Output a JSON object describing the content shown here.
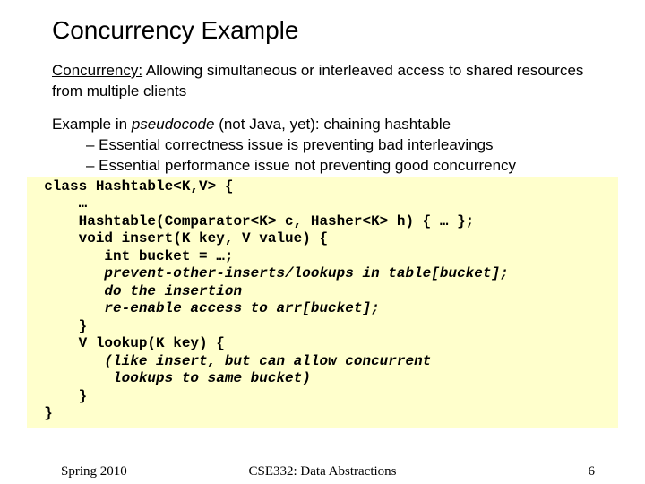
{
  "title": "Concurrency Example",
  "para1": {
    "term": "Concurrency:",
    "rest": " Allowing simultaneous or interleaved access to shared resources from multiple clients"
  },
  "para2": {
    "pre": "Example in ",
    "italic": "pseudocode",
    "post": " (not Java, yet): chaining hashtable"
  },
  "bullet1": "–  Essential correctness issue is preventing bad interleavings",
  "bullet2": "–  Essential performance issue not preventing good concurrency",
  "code": {
    "l1": "  class Hashtable<K,V> {",
    "l2": "      …",
    "l3": "      Hashtable(Comparator<K> c, Hasher<K> h) { … };",
    "l4": "      void insert(K key, V value) {",
    "l5": "         int bucket = …;",
    "l6": "         prevent-other-inserts/lookups in table[bucket];",
    "l7": "         do the insertion",
    "l8": "         re-enable access to arr[bucket];",
    "l9": "      }",
    "l10": "      V lookup(K key) {",
    "l11": "         (like insert, but can allow concurrent ",
    "l12": "          lookups to same bucket)",
    "l13": "      }",
    "l14": "  }"
  },
  "footer": {
    "left": "Spring 2010",
    "center": "CSE332: Data Abstractions",
    "right": "6"
  }
}
